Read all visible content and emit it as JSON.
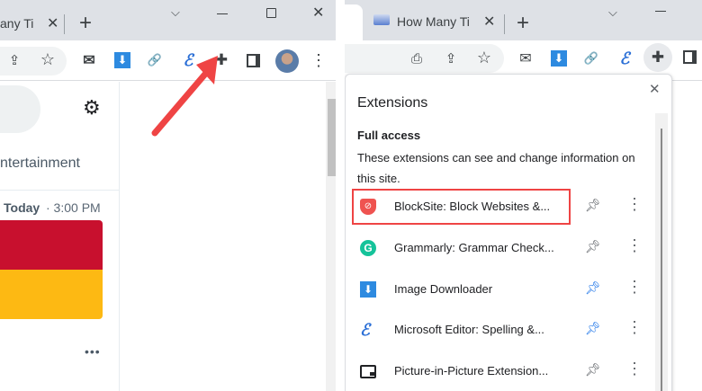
{
  "left": {
    "tab_title": "any Ti",
    "heading": "ntertainment",
    "date_label": "Today",
    "time": "· 3:00 PM"
  },
  "right": {
    "tab_title": "How Many Ti",
    "popup": {
      "title": "Extensions",
      "section_title": "Full access",
      "section_desc": "These extensions can see and change information on this site.",
      "items": [
        {
          "name": "BlockSite: Block Websites &...",
          "pinned": false
        },
        {
          "name": "Grammarly: Grammar Check...",
          "pinned": false
        },
        {
          "name": "Image Downloader",
          "pinned": true
        },
        {
          "name": "Microsoft Editor: Spelling &...",
          "pinned": true
        },
        {
          "name": "Picture-in-Picture Extension...",
          "pinned": false
        }
      ]
    }
  },
  "colors": {
    "highlight": "#ef4444",
    "pin_active": "#1a73e8",
    "banner_red": "#c8102e",
    "banner_yellow": "#fdb913"
  }
}
